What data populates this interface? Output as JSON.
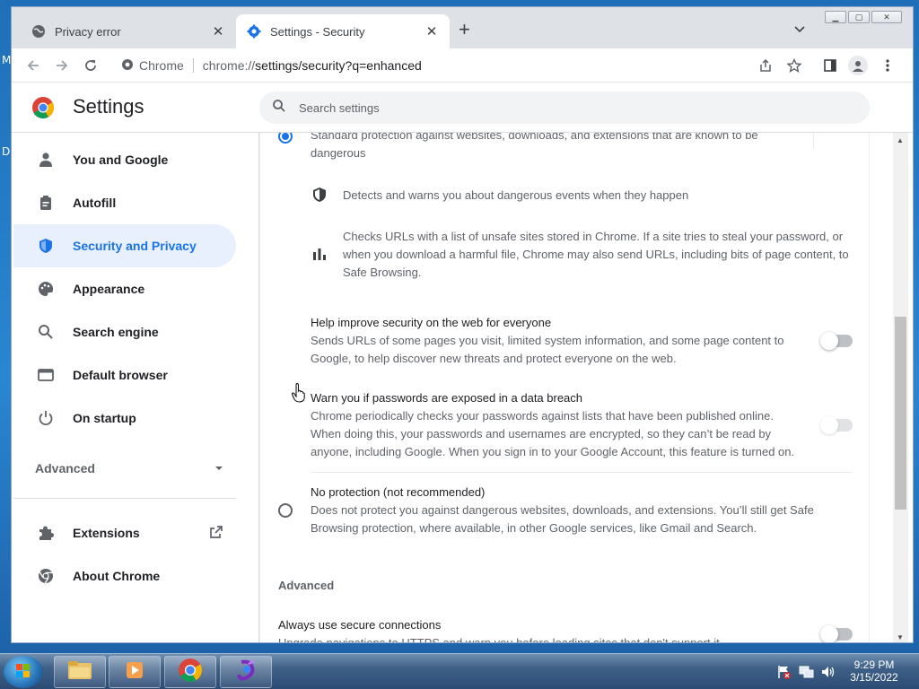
{
  "desktop": {
    "left_letters": [
      "M",
      "D"
    ]
  },
  "tabs": [
    {
      "title": "Privacy error",
      "close": "✕"
    },
    {
      "title": "Settings - Security",
      "close": "✕"
    }
  ],
  "new_tab": "+",
  "address_bar": {
    "site_label": "Chrome",
    "url_host": "chrome://",
    "url_path": "settings/security?q=enhanced"
  },
  "settings": {
    "title": "Settings",
    "search_placeholder": "Search settings"
  },
  "sidebar": {
    "items": [
      {
        "label": "You and Google",
        "icon": "person-icon"
      },
      {
        "label": "Autofill",
        "icon": "clipboard-icon"
      },
      {
        "label": "Security and Privacy",
        "icon": "shield-icon",
        "selected": true
      },
      {
        "label": "Appearance",
        "icon": "palette-icon"
      },
      {
        "label": "Search engine",
        "icon": "search-icon"
      },
      {
        "label": "Default browser",
        "icon": "browser-icon"
      },
      {
        "label": "On startup",
        "icon": "power-icon"
      }
    ],
    "advanced_label": "Advanced",
    "extensions_label": "Extensions",
    "about_label": "About Chrome"
  },
  "main": {
    "standard_partial_line": "Standard protection against websites, downloads, and extensions that are known to be",
    "standard_partial_line2": "dangerous",
    "detect_text": "Detects and warns you about dangerous events when they happen",
    "checks_text": "Checks URLs with a list of unsafe sites stored in Chrome. If a site tries to steal your password, or when you download a harmful file, Chrome may also send URLs, including bits of page content, to Safe Browsing.",
    "help_improve": {
      "title": "Help improve security on the web for everyone",
      "desc": "Sends URLs of some pages you visit, limited system information, and some page content to Google, to help discover new threats and protect everyone on the web.",
      "toggle_on": false
    },
    "warn_passwords": {
      "title": "Warn you if passwords are exposed in a data breach",
      "desc": "Chrome periodically checks your passwords against lists that have been published online. When doing this, your passwords and usernames are encrypted, so they can’t be read by anyone, including Google. When you sign in to your Google Account, this feature is turned on.",
      "toggle_on": false
    },
    "no_protection": {
      "title": "No protection (not recommended)",
      "desc": "Does not protect you against dangerous websites, downloads, and extensions. You’ll still get Safe Browsing protection, where available, in other Google services, like Gmail and Search."
    },
    "advanced_heading": "Advanced",
    "secure_connections": {
      "title": "Always use secure connections",
      "desc": "Upgrade navigations to HTTPS and warn you before loading sites that don't support it",
      "toggle_on": false
    }
  },
  "taskbar": {
    "time": "9:29 PM",
    "date": "3/15/2022"
  },
  "colors": {
    "accent": "#1a73e8",
    "selected_bg": "#e8f0fe",
    "text": "#202124",
    "secondary": "#5f6368"
  }
}
